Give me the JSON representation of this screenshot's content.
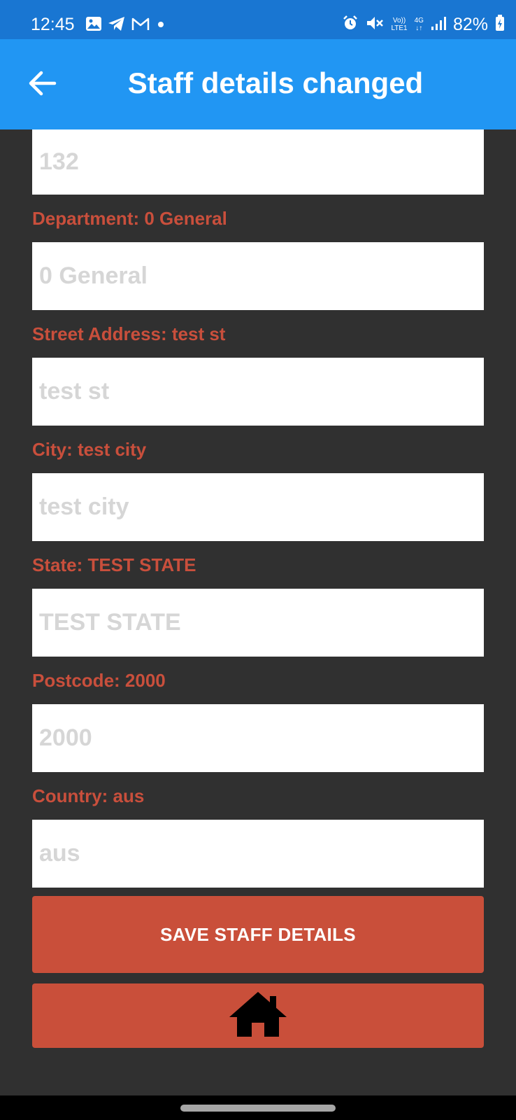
{
  "status_bar": {
    "time": "12:45",
    "battery": "82%",
    "network_top": "Vo))",
    "network_bottom": "LTE1",
    "data_type": "4G",
    "left_icons": [
      "gallery-icon",
      "telegram-icon",
      "gmail-icon",
      "dot-icon"
    ],
    "right_icons": [
      "alarm-icon",
      "mute-icon",
      "signal-icon",
      "battery-charging-icon"
    ]
  },
  "app_bar": {
    "title": "Staff details changed",
    "back_icon": "arrow-left-icon"
  },
  "form": {
    "first_field_value": "132",
    "fields": [
      {
        "label": "Department: 0 General",
        "value": "0 General"
      },
      {
        "label": "Street Address: test st",
        "value": "test st"
      },
      {
        "label": "City: test city",
        "value": "test city"
      },
      {
        "label": "State: TEST STATE",
        "value": "TEST STATE"
      },
      {
        "label": "Postcode: 2000",
        "value": "2000"
      },
      {
        "label": "Country: aus",
        "value": "aus"
      }
    ]
  },
  "actions": {
    "save_label": "SAVE STAFF DETAILS",
    "home_icon": "home-icon"
  },
  "colors": {
    "status_bar": "#1976d2",
    "app_bar": "#2196f3",
    "background": "#303030",
    "label": "#c94f3c",
    "button": "#c94f3a",
    "input_text": "#d6d6d6"
  }
}
